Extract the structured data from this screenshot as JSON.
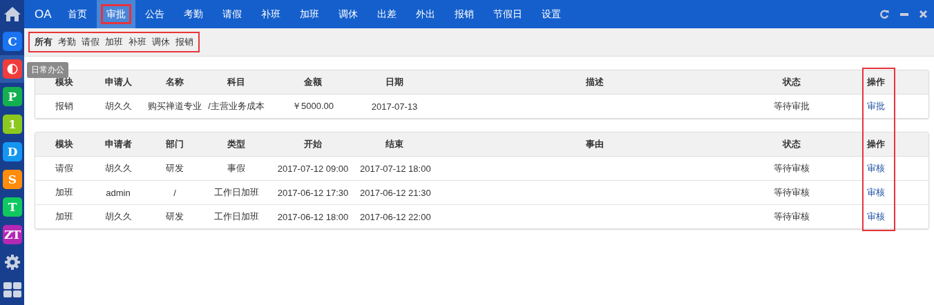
{
  "sidebar": {
    "apps": [
      {
        "kind": "letter",
        "label": "C",
        "color": "#1a73f0",
        "selected": false
      },
      {
        "kind": "half-circle",
        "color": "#f03c3c",
        "selected": true
      },
      {
        "kind": "letter",
        "label": "P",
        "color": "#14b050",
        "selected": false
      },
      {
        "kind": "letter",
        "label": "1",
        "color": "#8cc81e",
        "selected": false
      },
      {
        "kind": "letter",
        "label": "D",
        "color": "#1496f0",
        "selected": false
      },
      {
        "kind": "letter",
        "label": "S",
        "color": "#ff8c0a",
        "selected": false
      },
      {
        "kind": "letter",
        "label": "T",
        "color": "#10c860",
        "selected": false
      },
      {
        "kind": "letter",
        "label": "ZT",
        "color": "#b428b4",
        "selected": false
      }
    ],
    "tooltip": "日常办公"
  },
  "navbar": {
    "brand": "OA",
    "tabs": [
      {
        "label": "首页",
        "selected": false,
        "highlighted": false
      },
      {
        "label": "审批",
        "selected": true,
        "highlighted": true
      },
      {
        "label": "公告",
        "selected": false,
        "highlighted": false
      },
      {
        "label": "考勤",
        "selected": false,
        "highlighted": false
      },
      {
        "label": "请假",
        "selected": false,
        "highlighted": false
      },
      {
        "label": "补班",
        "selected": false,
        "highlighted": false
      },
      {
        "label": "加班",
        "selected": false,
        "highlighted": false
      },
      {
        "label": "调休",
        "selected": false,
        "highlighted": false
      },
      {
        "label": "出差",
        "selected": false,
        "highlighted": false
      },
      {
        "label": "外出",
        "selected": false,
        "highlighted": false
      },
      {
        "label": "报销",
        "selected": false,
        "highlighted": false
      },
      {
        "label": "节假日",
        "selected": false,
        "highlighted": false
      },
      {
        "label": "设置",
        "selected": false,
        "highlighted": false
      }
    ]
  },
  "subnav": {
    "highlighted": true,
    "items": [
      {
        "label": "所有",
        "selected": true
      },
      {
        "label": "考勤",
        "selected": false
      },
      {
        "label": "请假",
        "selected": false
      },
      {
        "label": "加班",
        "selected": false
      },
      {
        "label": "补班",
        "selected": false
      },
      {
        "label": "调休",
        "selected": false
      },
      {
        "label": "报销",
        "selected": false
      }
    ]
  },
  "action_column_highlighted": true,
  "tables": [
    {
      "columns": [
        "模块",
        "申请人",
        "名称",
        "科目",
        "金额",
        "日期",
        "描述",
        "状态",
        "操作"
      ],
      "rows": [
        [
          "报销",
          "胡久久",
          "购买禅道专业",
          "/主营业务成本",
          "￥5000.00",
          "2017-07-13",
          "",
          "等待审批",
          "审批"
        ]
      ]
    },
    {
      "columns": [
        "模块",
        "申请者",
        "部门",
        "类型",
        "开始",
        "结束",
        "事由",
        "状态",
        "操作"
      ],
      "rows": [
        [
          "请假",
          "胡久久",
          "研发",
          "事假",
          "2017-07-12 09:00",
          "2017-07-12 18:00",
          "",
          "等待审核",
          "审核"
        ],
        [
          "加班",
          "admin",
          "/",
          "工作日加班",
          "2017-06-12 17:30",
          "2017-06-12 21:30",
          "",
          "等待审核",
          "审核"
        ],
        [
          "加班",
          "胡久久",
          "研发",
          "工作日加班",
          "2017-06-12 18:00",
          "2017-06-12 22:00",
          "",
          "等待审核",
          "审核"
        ]
      ]
    }
  ]
}
